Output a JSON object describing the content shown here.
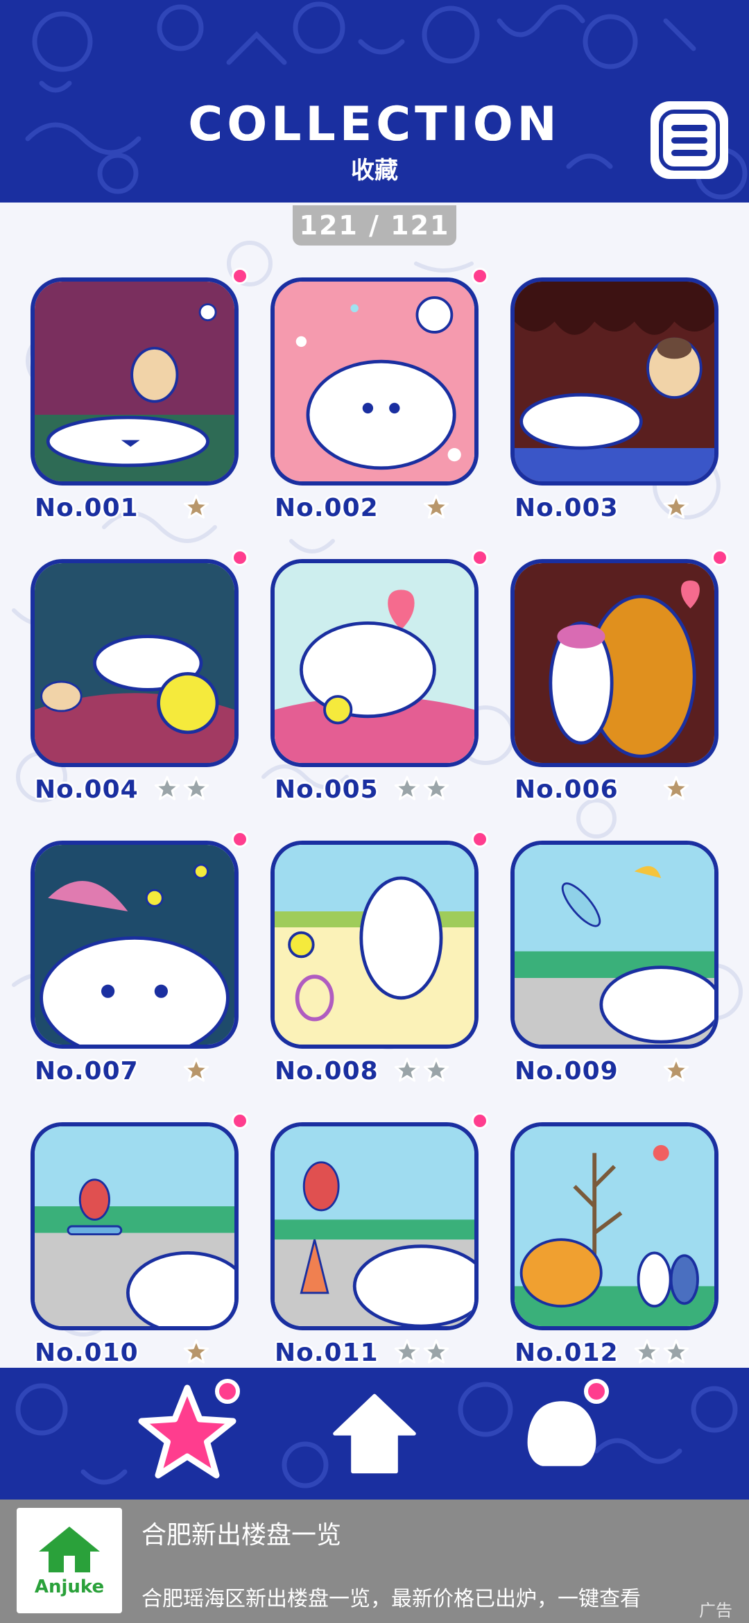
{
  "header": {
    "title": "COLLECTION",
    "subtitle": "收藏",
    "menu_icon": "menu-icon"
  },
  "progress": {
    "label": "121 / 121",
    "collected": 121,
    "total": 121
  },
  "items": [
    {
      "number": "No.001",
      "stars": 1,
      "max_stars": 2,
      "new_dot": true,
      "scene": "night-field"
    },
    {
      "number": "No.002",
      "stars": 1,
      "max_stars": 2,
      "new_dot": true,
      "scene": "pink-baseball"
    },
    {
      "number": "No.003",
      "stars": 1,
      "max_stars": 2,
      "new_dot": false,
      "scene": "chocolate-pug"
    },
    {
      "number": "No.004",
      "stars": 0,
      "max_stars": 2,
      "new_dot": true,
      "scene": "teal-tennis-ball"
    },
    {
      "number": "No.005",
      "stars": 0,
      "max_stars": 2,
      "new_dot": true,
      "scene": "heart-cushion"
    },
    {
      "number": "No.006",
      "stars": 1,
      "max_stars": 2,
      "new_dot": true,
      "scene": "bear-hug"
    },
    {
      "number": "No.007",
      "stars": 1,
      "max_stars": 2,
      "new_dot": true,
      "scene": "bees"
    },
    {
      "number": "No.008",
      "stars": 0,
      "max_stars": 2,
      "new_dot": true,
      "scene": "tennis-racket"
    },
    {
      "number": "No.009",
      "stars": 1,
      "max_stars": 2,
      "new_dot": false,
      "scene": "monkey-fall"
    },
    {
      "number": "No.010",
      "stars": 1,
      "max_stars": 2,
      "new_dot": true,
      "scene": "monkey-skate"
    },
    {
      "number": "No.011",
      "stars": 0,
      "max_stars": 2,
      "new_dot": true,
      "scene": "monkey-cone"
    },
    {
      "number": "No.012",
      "stars": 0,
      "max_stars": 2,
      "new_dot": false,
      "scene": "tree-park"
    }
  ],
  "nav": [
    {
      "icon": "star-icon",
      "active": true,
      "badge": true
    },
    {
      "icon": "home-icon",
      "active": false,
      "badge": false
    },
    {
      "icon": "dog-head-icon",
      "active": false,
      "badge": true
    }
  ],
  "ad": {
    "brand": "Anjuke",
    "title": "合肥新出楼盘一览",
    "description": "合肥瑶海区新出楼盘一览，最新价格已出炉，一键查看",
    "tag": "广告"
  },
  "colors": {
    "primary": "#1a2fa0",
    "accent_pink": "#ff3d8e",
    "star_earned": "#b8966a",
    "star_empty": "#9aa4a8",
    "ad_bg": "#8a8a8a"
  }
}
